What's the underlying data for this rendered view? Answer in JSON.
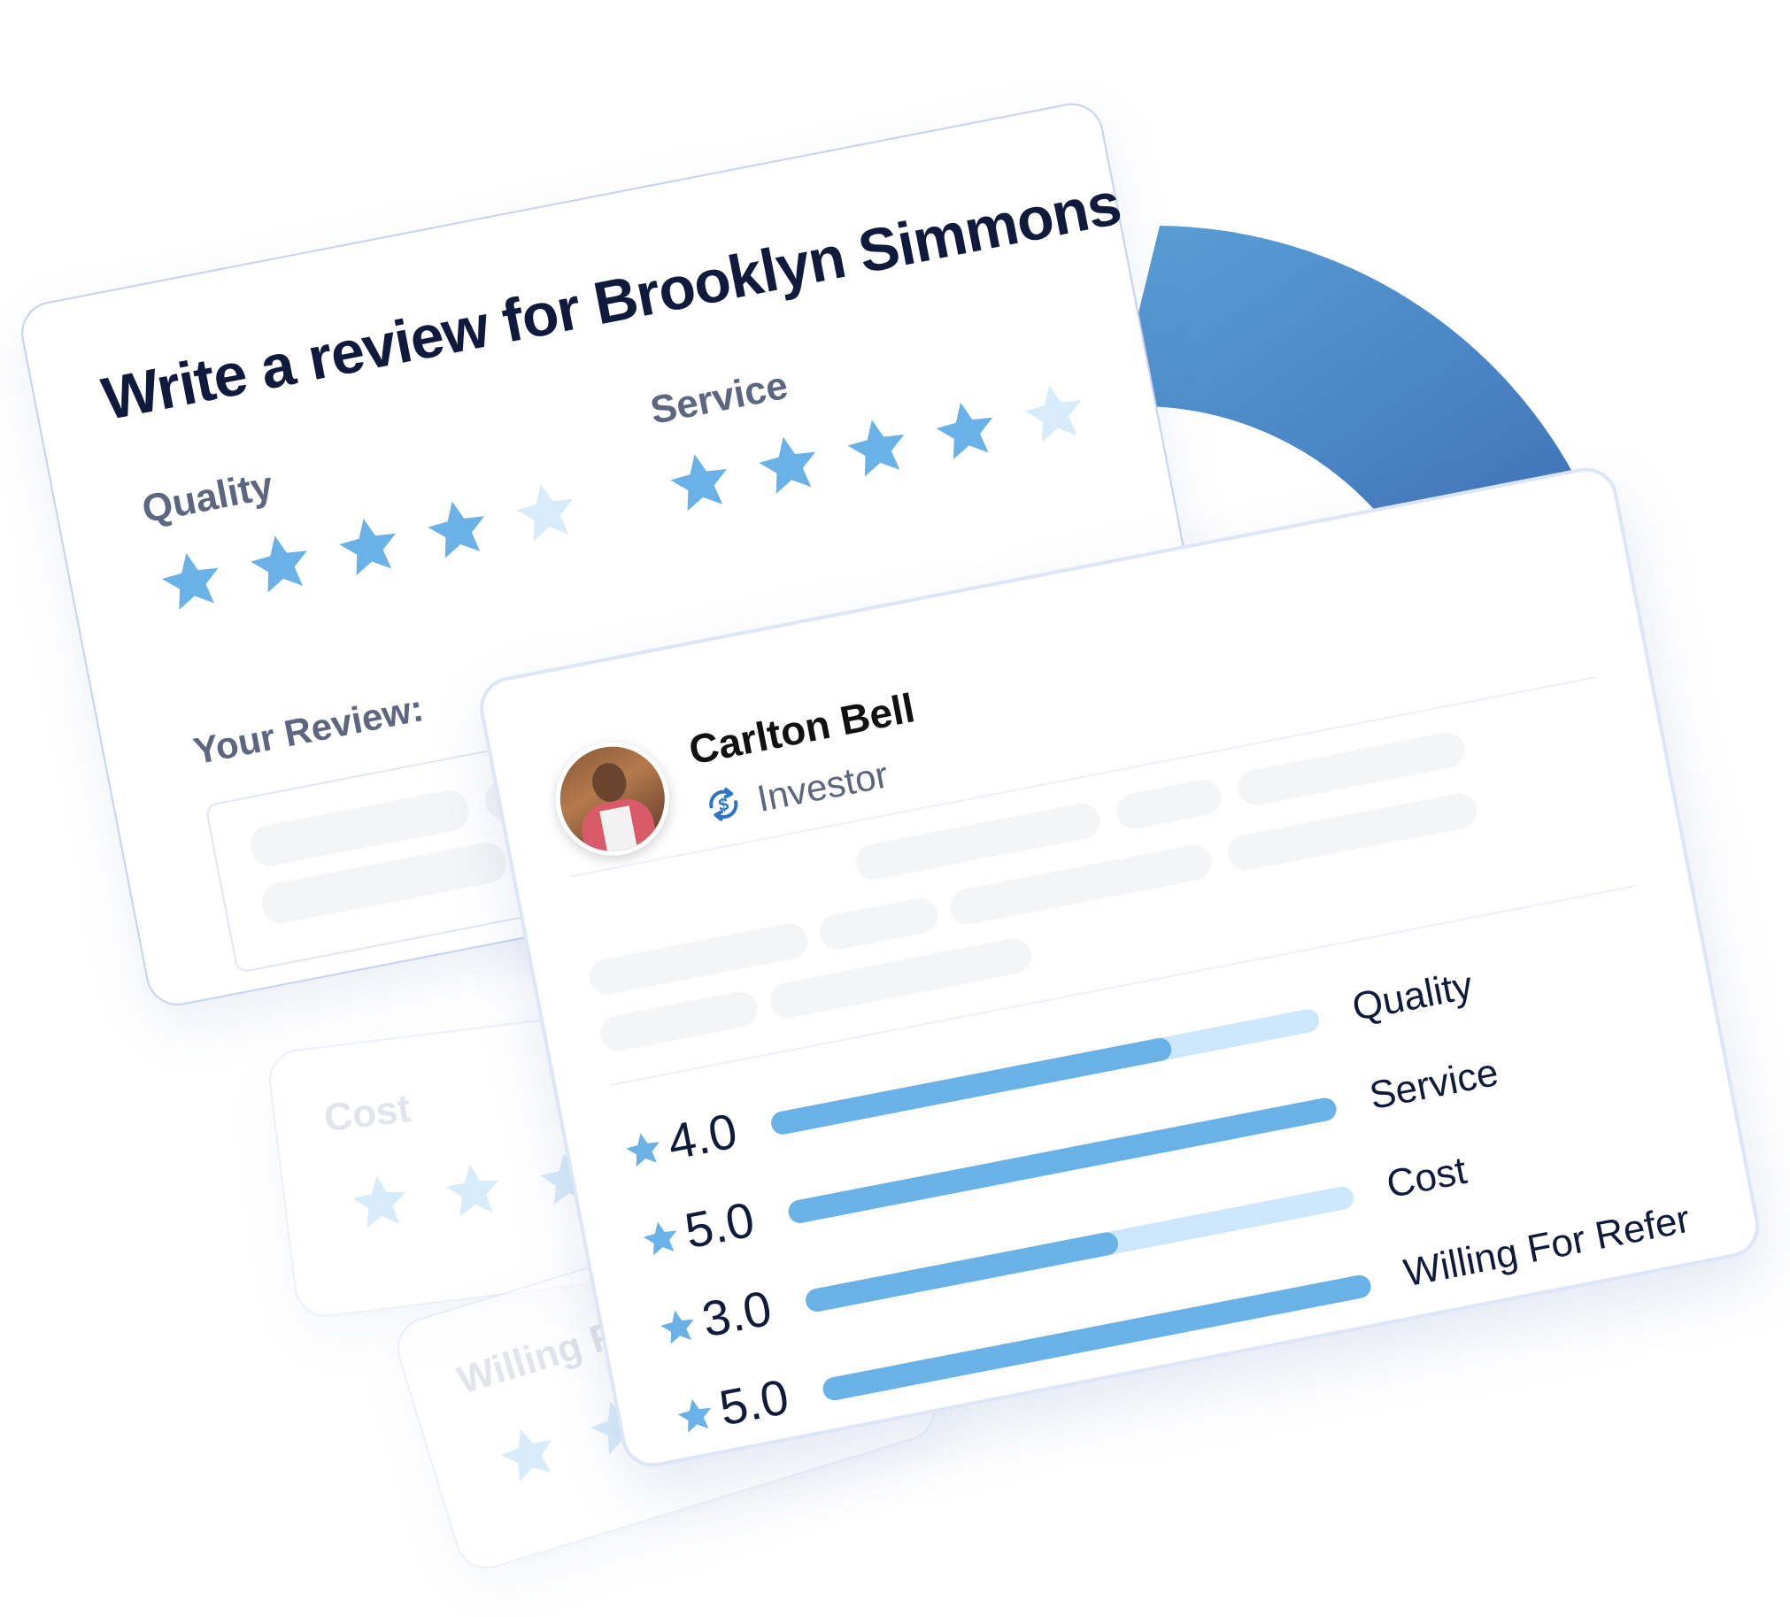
{
  "colors": {
    "star": "#69b1e7",
    "star_faded": "#d8ebfa",
    "donut_start": "#5a9fd6",
    "donut_end": "#3f72b8",
    "title": "#0f1a3c",
    "muted": "#5d6680"
  },
  "review_card": {
    "title": "Write a review for Brooklyn Simmons",
    "quality_label": "Quality",
    "quality_rating": 4,
    "service_label": "Service",
    "service_rating": 4,
    "your_review_label": "Your Review:",
    "max_stars": 5
  },
  "ghost_cards": {
    "cost_label": "Cost",
    "willing_label": "Willing For Refer"
  },
  "profile_card": {
    "name": "Carlton Bell",
    "role": "Investor",
    "role_icon": "dollar-exchange-icon",
    "ratings": [
      {
        "label": "Quality",
        "score": "4.0",
        "fraction": 0.73
      },
      {
        "label": "Service",
        "score": "5.0",
        "fraction": 1.0
      },
      {
        "label": "Cost",
        "score": "3.0",
        "fraction": 0.57
      },
      {
        "label": "Willing For Refer",
        "score": "5.0",
        "fraction": 1.0
      }
    ]
  }
}
